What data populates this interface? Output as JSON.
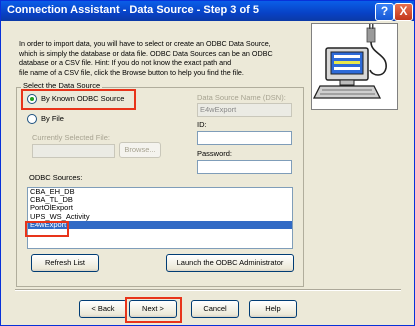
{
  "window": {
    "title": "Connection Assistant - Data Source - Step 3 of 5",
    "help_btn": "?",
    "close_btn": "X"
  },
  "intro": {
    "lines": [
      "In order to import data, you will have to select or create an ODBC Data Source,",
      "which is simply the database or data file. ODBC Data Sources can be an ODBC",
      "database or a CSV file.  Hint: If you do not know the exact path and",
      "file name of a CSV file, click the Browse button to help you find the file."
    ]
  },
  "data_source": {
    "group_label": "Select the Data Source",
    "options": [
      {
        "label": "By Known ODBC Source",
        "selected": true
      },
      {
        "label": "By File",
        "selected": false
      }
    ],
    "currently_selected_file_label": "Currently Selected File:",
    "currently_selected_file_value": "",
    "browse_label": "Browse...",
    "dsn_label": "Data Source Name (DSN):",
    "dsn_value": "E4wExport",
    "id_label": "ID:",
    "id_value": "",
    "password_label": "Password:",
    "password_value": ""
  },
  "odbc": {
    "label": "ODBC Sources:",
    "sources": [
      "CBA_EH_DB",
      "CBA_TL_DB",
      "PortOlExport",
      "UPS_WS_Activity",
      "E4wExport"
    ],
    "selected": "E4wExport",
    "refresh_label": "Refresh List",
    "admin_label": "Launch the ODBC Administrator"
  },
  "footer": {
    "back_label": "< Back",
    "next_label": "Next >",
    "cancel_label": "Cancel",
    "help_label": "Help"
  },
  "colors": {
    "title_blue": "#0842c6",
    "highlight_red": "#e8341a",
    "selection_blue": "#316ac5",
    "radio_green": "#21a121"
  }
}
